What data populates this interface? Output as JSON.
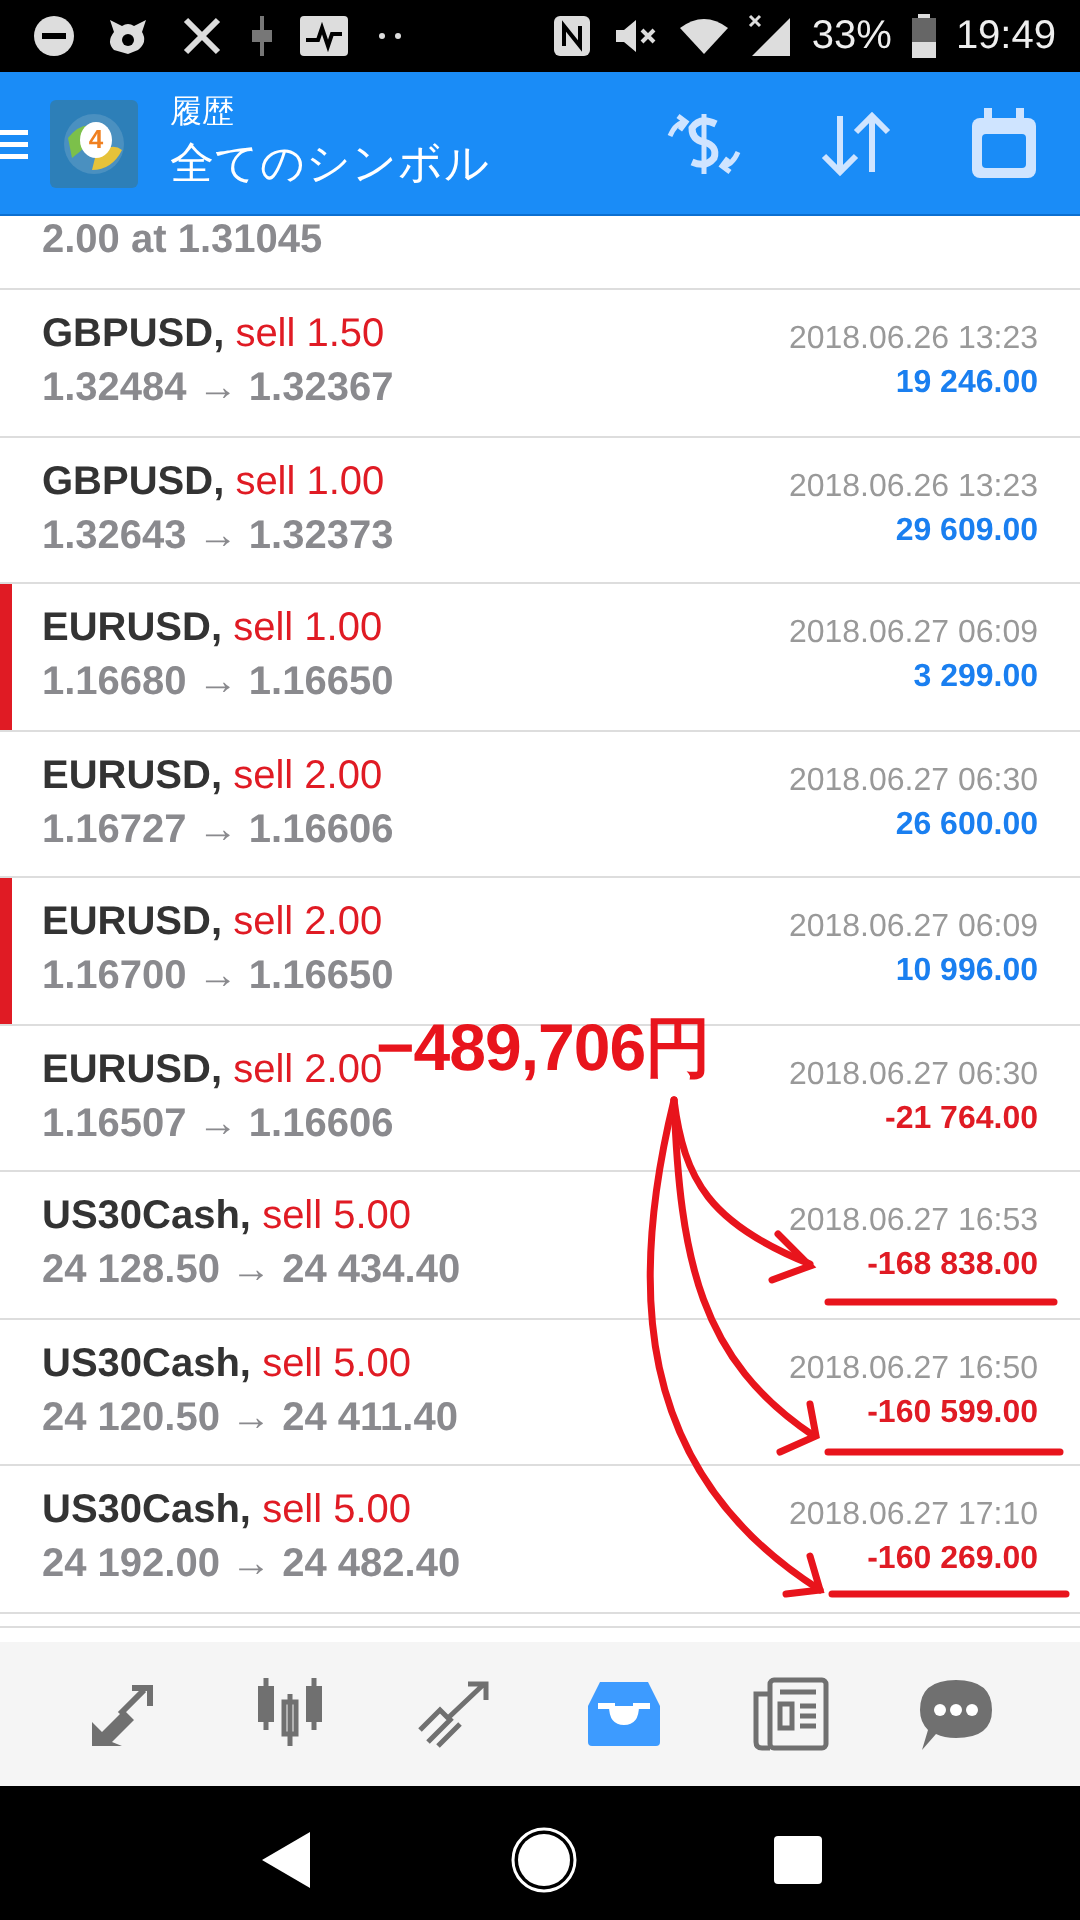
{
  "status_bar": {
    "battery": "33%",
    "time": "19:49"
  },
  "header": {
    "logo_text": "4",
    "title": "履歴",
    "subtitle": "全てのシンボル"
  },
  "partial_row": {
    "text": "2.00 at 1.31045"
  },
  "deals": [
    {
      "symbol": "GBPUSD,",
      "side": "sell 1.50",
      "prices": "1.32484 → 1.32367",
      "time": "2018.06.26 13:23",
      "profit": "19 246.00",
      "negative": false,
      "marked": false
    },
    {
      "symbol": "GBPUSD,",
      "side": "sell 1.00",
      "prices": "1.32643 → 1.32373",
      "time": "2018.06.26 13:23",
      "profit": "29 609.00",
      "negative": false,
      "marked": false
    },
    {
      "symbol": "EURUSD,",
      "side": "sell 1.00",
      "prices": "1.16680 → 1.16650",
      "time": "2018.06.27 06:09",
      "profit": "3 299.00",
      "negative": false,
      "marked": true
    },
    {
      "symbol": "EURUSD,",
      "side": "sell 2.00",
      "prices": "1.16727 → 1.16606",
      "time": "2018.06.27 06:30",
      "profit": "26 600.00",
      "negative": false,
      "marked": false
    },
    {
      "symbol": "EURUSD,",
      "side": "sell 2.00",
      "prices": "1.16700 → 1.16650",
      "time": "2018.06.27 06:09",
      "profit": "10 996.00",
      "negative": false,
      "marked": true
    },
    {
      "symbol": "EURUSD,",
      "side": "sell 2.00",
      "prices": "1.16507 → 1.16606",
      "time": "2018.06.27 06:30",
      "profit": "-21 764.00",
      "negative": true,
      "marked": false
    },
    {
      "symbol": "US30Cash,",
      "side": "sell 5.00",
      "prices": "24 128.50 → 24 434.40",
      "time": "2018.06.27 16:53",
      "profit": "-168 838.00",
      "negative": true,
      "marked": false
    },
    {
      "symbol": "US30Cash,",
      "side": "sell 5.00",
      "prices": "24 120.50 → 24 411.40",
      "time": "2018.06.27 16:50",
      "profit": "-160 599.00",
      "negative": true,
      "marked": false
    },
    {
      "symbol": "US30Cash,",
      "side": "sell 5.00",
      "prices": "24 192.00 → 24 482.40",
      "time": "2018.06.27 17:10",
      "profit": "-160 269.00",
      "negative": true,
      "marked": false
    }
  ],
  "annotation": {
    "text": "−489,706円"
  },
  "bottom_tabs": [
    {
      "kind": "trade",
      "selected": false
    },
    {
      "kind": "quotes",
      "selected": false
    },
    {
      "kind": "chart",
      "selected": false
    },
    {
      "kind": "history",
      "selected": true
    },
    {
      "kind": "news",
      "selected": false
    },
    {
      "kind": "chat",
      "selected": false
    }
  ]
}
